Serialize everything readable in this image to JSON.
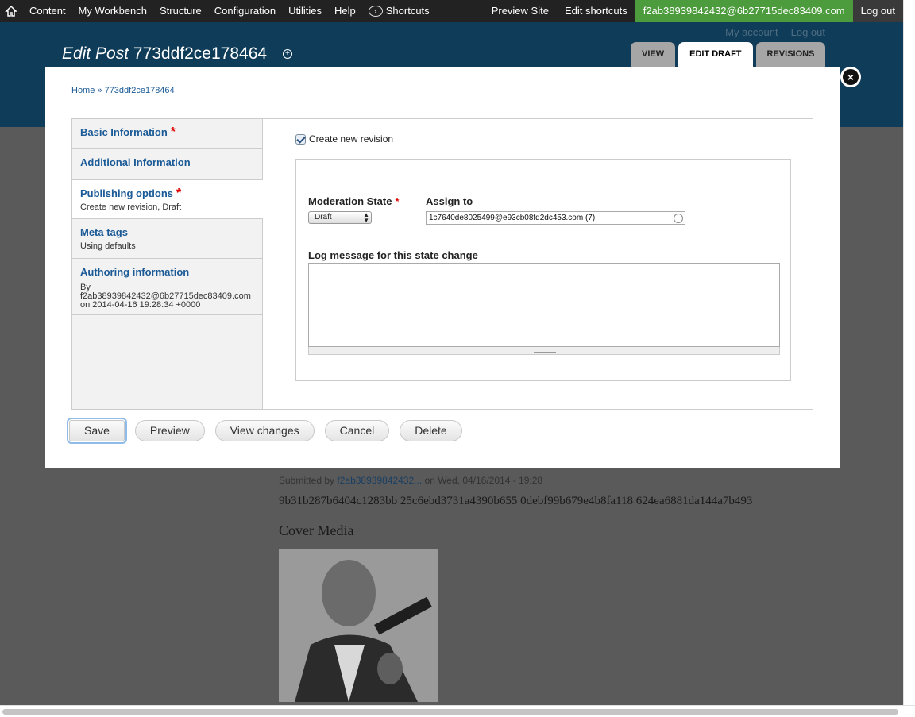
{
  "toolbar": {
    "menu": [
      "Content",
      "My Workbench",
      "Structure",
      "Configuration",
      "Utilities",
      "Help"
    ],
    "shortcuts": "Shortcuts",
    "preview_site": "Preview Site",
    "edit_shortcuts": "Edit shortcuts",
    "user": "f2ab38939842432@6b27715dec83409.com",
    "logout": "Log out"
  },
  "header": {
    "secondary": {
      "my_account": "My account",
      "log_out": "Log out"
    },
    "title_prefix": "Edit Post",
    "title_id": "773ddf2ce178464",
    "tabs": [
      "VIEW",
      "EDIT DRAFT",
      "REVISIONS"
    ]
  },
  "background": {
    "submitted_prefix": "Submitted by",
    "submitted_user": "f2ab38939842432...",
    "submitted_suffix": "on Wed, 04/16/2014 - 19:28",
    "body": "9b31b287b6404c1283bb 25c6ebd3731a4390b655 0debf99b679e4b8fa118 624ea6881da144a7b493",
    "cover_heading": "Cover Media"
  },
  "overlay": {
    "breadcrumb": "Home » 773ddf2ce178464",
    "vtabs": [
      {
        "label": "Basic Information",
        "required": "*",
        "summary": ""
      },
      {
        "label": "Additional Information",
        "required": "",
        "summary": ""
      },
      {
        "label": "Publishing options",
        "required": "*",
        "summary": "Create new revision, Draft"
      },
      {
        "label": "Meta tags",
        "required": "",
        "summary": "Using defaults"
      },
      {
        "label": "Authoring information",
        "required": "",
        "summary_lines": [
          "By",
          "f2ab38939842432@6b27715dec83409.com",
          "on 2014-04-16 19:28:34 +0000"
        ]
      }
    ],
    "pane": {
      "create_revision": "Create new revision",
      "moderation_label": "Moderation State",
      "required_mark": "*",
      "moderation_value": "Draft",
      "assign_label": "Assign to",
      "assign_value": "1c7640de8025499@e93cb08fd2dc453.com (7)",
      "log_label": "Log message for this state change",
      "log_value": ""
    },
    "buttons": {
      "save": "Save",
      "preview": "Preview",
      "view_changes": "View changes",
      "cancel": "Cancel",
      "delete": "Delete"
    }
  }
}
